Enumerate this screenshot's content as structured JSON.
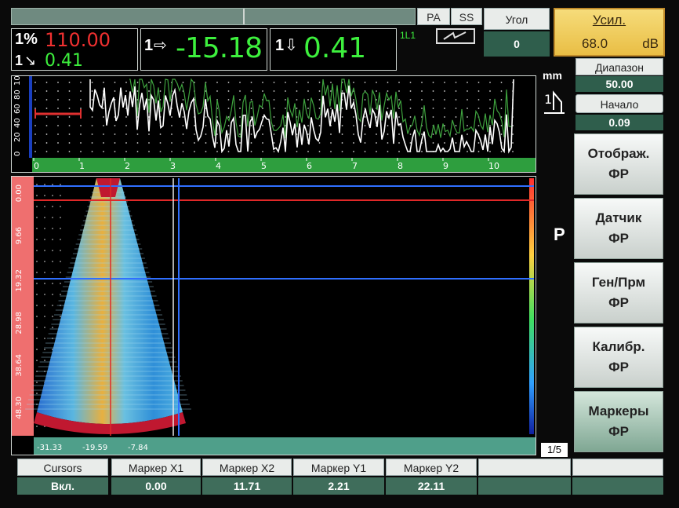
{
  "header": {
    "mode_pa": "PA",
    "mode_ss": "SS",
    "angle_label": "Угол",
    "angle_value": "0",
    "gain_label": "Усил.",
    "gain_value": "68.0",
    "gain_unit": "dB",
    "range_label": "Диапазон",
    "range_value": "50.00",
    "start_label": "Начало",
    "start_value": "0.09",
    "link_label": "1L1",
    "unit_label": "mm"
  },
  "measurements": {
    "m1_prefix": "1%",
    "m1_value": "110.00",
    "m1b_prefix": "1",
    "m1b_value": "0.41",
    "m2_prefix": "1",
    "m2_value": "-15.18",
    "m3_prefix": "1",
    "m3_value": "0.41"
  },
  "ascan": {
    "y_ticks": [
      "100",
      "80",
      "60",
      "40",
      "20",
      "0"
    ],
    "x_ticks": [
      "0",
      "1",
      "2",
      "3",
      "4",
      "5",
      "6",
      "7",
      "8",
      "9",
      "10"
    ],
    "colors": {
      "trace": "#ffffff",
      "envelope": "#3fa33f",
      "gate": "#e03030",
      "axis": "#2e9e3e",
      "left_axis": "#1a3fbf"
    }
  },
  "sscan": {
    "y_ticks": [
      "0.00",
      "9.66",
      "19.32",
      "28.98",
      "38.64",
      "48.30"
    ],
    "x_ticks": [
      "-31.33",
      "-19.59",
      "-7.84"
    ],
    "page_indicator": "1/5",
    "p_label": "P",
    "colors": {
      "cursor_blue": "#2f6fff",
      "cursor_red": "#e02828",
      "ruler": "#ef6f6f",
      "bottom_ruler": "#4f9f8a"
    }
  },
  "menu": [
    {
      "line1": "Отображ.",
      "line2": "ФР"
    },
    {
      "line1": "Датчик",
      "line2": "ФР"
    },
    {
      "line1": "Ген/Прм",
      "line2": "ФР"
    },
    {
      "line1": "Калибр.",
      "line2": "ФР"
    },
    {
      "line1": "Маркеры",
      "line2": "ФР"
    }
  ],
  "bottom": {
    "labels": [
      "Cursors",
      "Маркер X1",
      "Маркер X2",
      "Маркер Y1",
      "Маркер Y2",
      "",
      ""
    ],
    "values": [
      "Вкл.",
      "0.00",
      "11.71",
      "2.21",
      "22.11",
      "",
      ""
    ]
  }
}
